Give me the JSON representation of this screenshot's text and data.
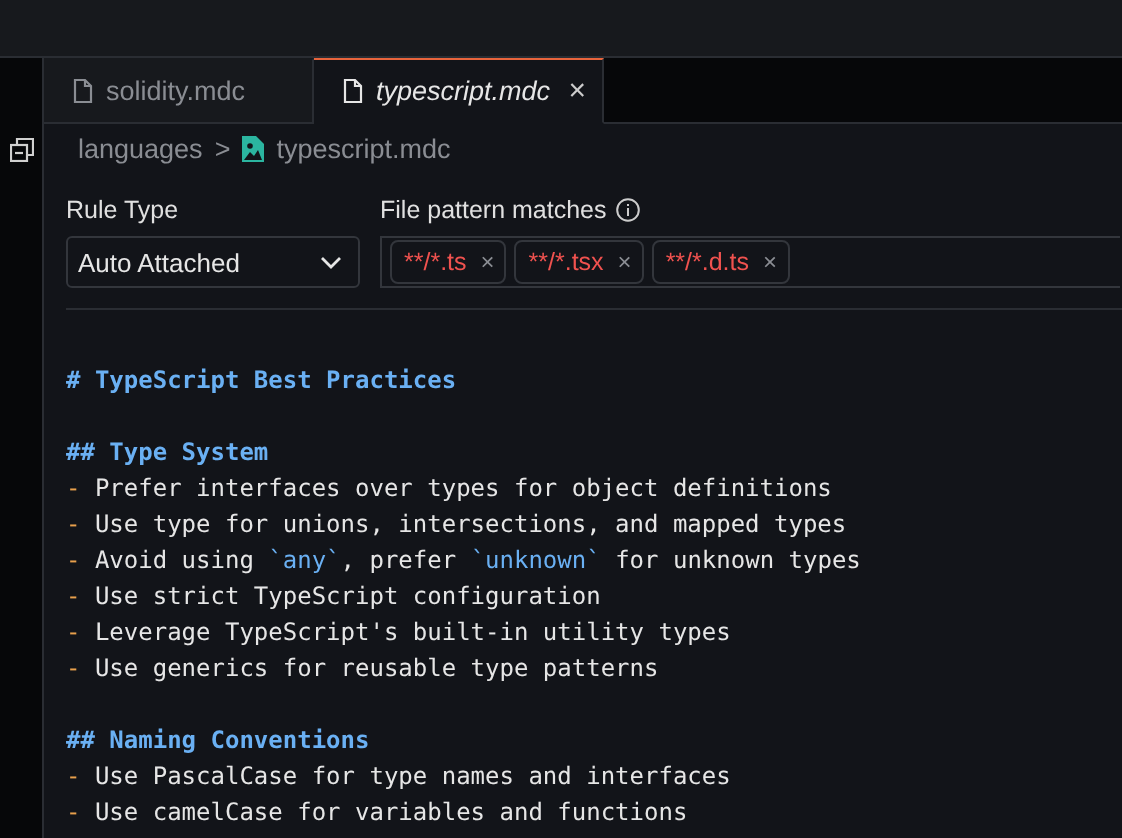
{
  "tabs": [
    {
      "label": "solidity.mdc",
      "selected": false
    },
    {
      "label": "typescript.mdc",
      "selected": true
    }
  ],
  "breadcrumb": {
    "folder": "languages",
    "separator": ">",
    "file": "typescript.mdc"
  },
  "rule_type": {
    "label": "Rule Type",
    "value": "Auto Attached"
  },
  "file_patterns": {
    "label": "File pattern matches",
    "tags": [
      "**/*.ts",
      "**/*.tsx",
      "**/*.d.ts"
    ],
    "remove": "×"
  },
  "editor": {
    "lines": [
      {
        "kind": "blank"
      },
      {
        "kind": "heading",
        "segments": [
          {
            "text": "# TypeScript Best Practices",
            "code": false
          }
        ]
      },
      {
        "kind": "blank"
      },
      {
        "kind": "heading",
        "segments": [
          {
            "text": "## Type System",
            "code": false
          }
        ]
      },
      {
        "kind": "bullet",
        "marker": "-",
        "segments": [
          {
            "text": "Prefer interfaces over types for object definitions",
            "code": false
          }
        ]
      },
      {
        "kind": "bullet",
        "marker": "-",
        "segments": [
          {
            "text": "Use type for unions, intersections, and mapped types",
            "code": false
          }
        ]
      },
      {
        "kind": "bullet",
        "marker": "-",
        "segments": [
          {
            "text": "Avoid using ",
            "code": false
          },
          {
            "text": "`any`",
            "code": true
          },
          {
            "text": ", prefer ",
            "code": false
          },
          {
            "text": "`unknown`",
            "code": true
          },
          {
            "text": " for unknown types",
            "code": false
          }
        ]
      },
      {
        "kind": "bullet",
        "marker": "-",
        "segments": [
          {
            "text": "Use strict TypeScript configuration",
            "code": false
          }
        ]
      },
      {
        "kind": "bullet",
        "marker": "-",
        "segments": [
          {
            "text": "Leverage TypeScript's built-in utility types",
            "code": false
          }
        ]
      },
      {
        "kind": "bullet",
        "marker": "-",
        "segments": [
          {
            "text": "Use generics for reusable type patterns",
            "code": false
          }
        ]
      },
      {
        "kind": "blank"
      },
      {
        "kind": "heading",
        "segments": [
          {
            "text": "## Naming Conventions",
            "code": false
          }
        ]
      },
      {
        "kind": "bullet",
        "marker": "-",
        "segments": [
          {
            "text": "Use PascalCase for type names and interfaces",
            "code": false
          }
        ]
      },
      {
        "kind": "bullet",
        "marker": "-",
        "segments": [
          {
            "text": "Use camelCase for variables and functions",
            "code": false
          }
        ]
      }
    ]
  }
}
